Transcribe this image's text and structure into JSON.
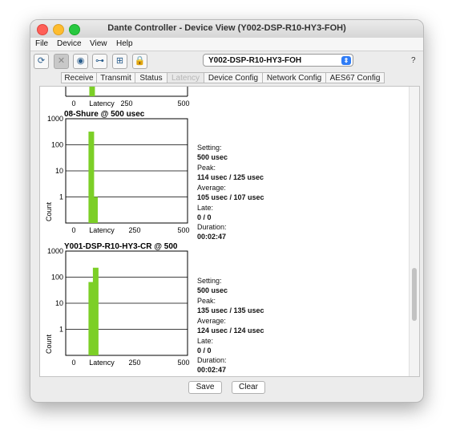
{
  "window": {
    "title": "Dante Controller - Device View (Y002-DSP-R10-HY3-FOH)"
  },
  "menu": [
    "File",
    "Device",
    "View",
    "Help"
  ],
  "toolbar": {
    "device": "Y002-DSP-R10-HY3-FOH",
    "help": "?"
  },
  "tabs": [
    {
      "label": "Receive",
      "active": false
    },
    {
      "label": "Transmit",
      "active": false
    },
    {
      "label": "Status",
      "active": false
    },
    {
      "label": "Latency",
      "active": true
    },
    {
      "label": "Device Config",
      "active": false
    },
    {
      "label": "Network Config",
      "active": false
    },
    {
      "label": "AES67 Config",
      "active": false
    }
  ],
  "buttons": {
    "save": "Save",
    "clear": "Clear"
  },
  "stat_labels": {
    "setting": "Setting:",
    "peak": "Peak:",
    "average": "Average:",
    "late": "Late:",
    "duration": "Duration:"
  },
  "chart_data": [
    {
      "type": "bar",
      "title": "",
      "xlabel": "Latency",
      "ylabel": "",
      "x_ticks": [
        "0",
        "250",
        "500"
      ],
      "partial": true,
      "bars": [
        {
          "x": 110,
          "count": 1
        }
      ]
    },
    {
      "type": "bar",
      "title": "08-Shure @ 500 usec",
      "xlabel": "Latency",
      "ylabel": "Count",
      "yscale": "log",
      "ylim": [
        0.1,
        1000
      ],
      "y_ticks": [
        "1000",
        "100",
        "10",
        "1"
      ],
      "x_ticks": [
        "0",
        "250",
        "500"
      ],
      "xlim": [
        0,
        500
      ],
      "bars": [
        {
          "x": 105,
          "count": 320
        },
        {
          "x": 120,
          "count": 1
        }
      ],
      "stats": {
        "setting": "500 usec",
        "peak": "114 usec / 125 usec",
        "average": "105 usec / 107 usec",
        "late": "0 / 0",
        "duration": "00:02:47"
      }
    },
    {
      "type": "bar",
      "title": "Y001-DSP-R10-HY3-CR @ 500",
      "xlabel": "Latency",
      "ylabel": "Count",
      "yscale": "log",
      "ylim": [
        0.1,
        1000
      ],
      "y_ticks": [
        "1000",
        "100",
        "10",
        "1"
      ],
      "x_ticks": [
        "0",
        "250",
        "500"
      ],
      "xlim": [
        0,
        500
      ],
      "bars": [
        {
          "x": 105,
          "count": 65
        },
        {
          "x": 123,
          "count": 230
        }
      ],
      "stats": {
        "setting": "500 usec",
        "peak": "135 usec / 135 usec",
        "average": "124 usec / 124 usec",
        "late": "0 / 0",
        "duration": "00:02:47"
      }
    }
  ]
}
